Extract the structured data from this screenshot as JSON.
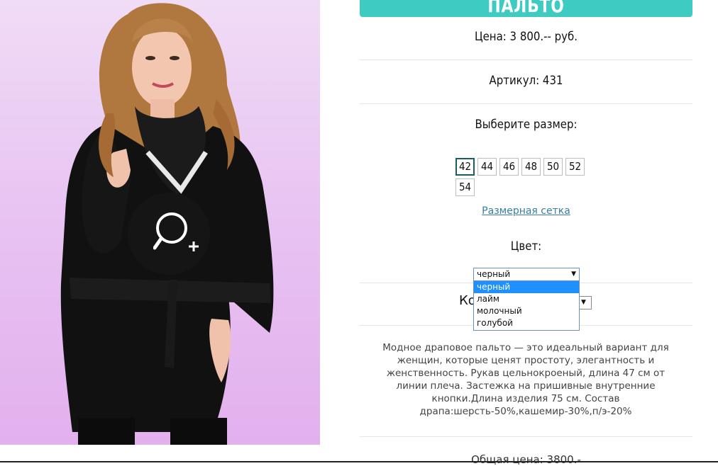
{
  "product": {
    "title": "ПАЛЬТО",
    "price": "Цена: 3 800.-- руб.",
    "sku": "Артикул: 431",
    "choose_size": "Выберите размер:",
    "sizes": [
      "42",
      "44",
      "46",
      "48",
      "50",
      "52",
      "54"
    ],
    "selected_size": "42",
    "size_chart_link": "Размерная сетка",
    "color_label": "Цвет:",
    "color_selected": "черный",
    "color_options": [
      "черный",
      "лайм",
      "молочный",
      "голубой"
    ],
    "qty_label_partial": "Ко",
    "description": "Модное драповое пальто — это идеальный вариант для женщин, которые ценят простоту, элегантность и женственность. Рукав цельнокроеный, длина 47 см от линии плеча. Застежка на пришивные внутренние кнопки.Длина изделия 75 см. Состав драпа:шерсть-50%,кашемир-30%,п/э-20%",
    "total": "Общая цена: 3800.-"
  },
  "icons": {
    "zoom": "zoom-in-icon",
    "dropdown": "chevron-down-icon"
  },
  "colors": {
    "accent": "#3ecbc1",
    "link": "#3a7ea1",
    "highlight": "#1e90ff"
  }
}
